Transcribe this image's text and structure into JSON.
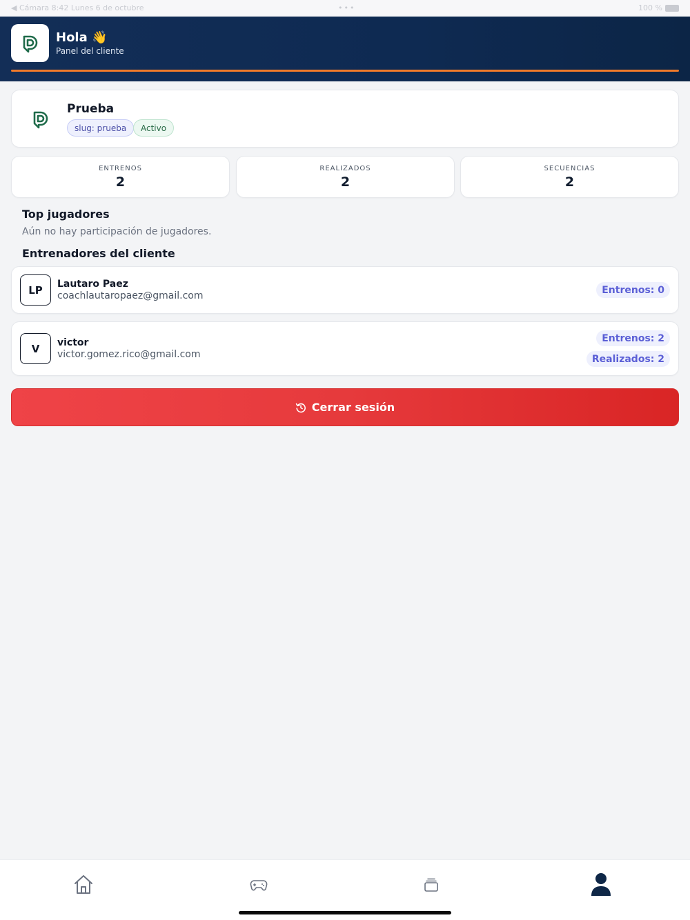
{
  "status_bar": {
    "back_label": "◀ Cámara",
    "time": "8:42",
    "date": "Lunes 6 de octubre",
    "dots": "•••",
    "battery_text": "100 %"
  },
  "header": {
    "greeting": "Hola 👋",
    "subtitle": "Panel del cliente"
  },
  "client": {
    "name": "Prueba",
    "slug_chip": "slug: prueba",
    "status_chip": "Activo"
  },
  "stats": [
    {
      "label": "ENTRENOS",
      "value": "2"
    },
    {
      "label": "REALIZADOS",
      "value": "2"
    },
    {
      "label": "SECUENCIAS",
      "value": "2"
    }
  ],
  "top_players": {
    "title": "Top jugadores",
    "empty": "Aún no hay participación de jugadores."
  },
  "coaches": {
    "title": "Entrenadores del cliente",
    "items": [
      {
        "initials": "LP",
        "name": "Lautaro Paez",
        "email": "coachlautaropaez@gmail.com",
        "badges": [
          "Entrenos: 0"
        ]
      },
      {
        "initials": "V",
        "name": "victor",
        "email": "victor.gomez.rico@gmail.com",
        "badges": [
          "Entrenos: 2",
          "Realizados: 2"
        ]
      }
    ]
  },
  "logout": {
    "label": "Cerrar sesión",
    "icon": "logout-icon"
  },
  "bottom_nav": [
    {
      "name": "home-icon",
      "active": false
    },
    {
      "name": "gamepad-icon",
      "active": false
    },
    {
      "name": "stack-icon",
      "active": false
    },
    {
      "name": "profile-icon",
      "active": true
    }
  ],
  "colors": {
    "header_bg": "#0e2a52",
    "accent_orange": "#f07a2a",
    "logout_red": "#e63a3c",
    "badge_text": "#5b5fd6",
    "brand_green": "#1f6b4a"
  }
}
